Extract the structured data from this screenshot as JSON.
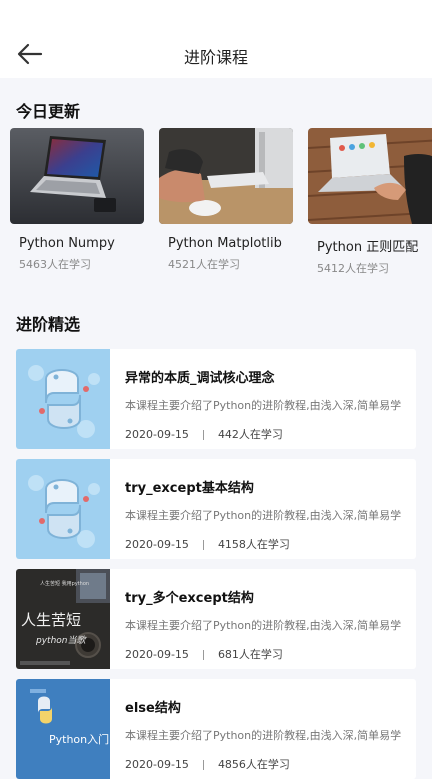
{
  "header": {
    "title": "进阶课程"
  },
  "today": {
    "title": "今日更新",
    "items": [
      {
        "name": "Python Numpy",
        "learners": "5463人在学习"
      },
      {
        "name": "Python Matplotlib",
        "learners": "4521人在学习"
      },
      {
        "name": "Python 正则匹配",
        "learners": "5412人在学习"
      }
    ]
  },
  "featured": {
    "title": "进阶精选",
    "items": [
      {
        "title": "异常的本质_调试核心理念",
        "desc": "本课程主要介绍了Python的进阶教程,由浅入深,简单易学",
        "date": "2020-09-15",
        "learners": "442人在学习"
      },
      {
        "title": "try_except基本结构",
        "desc": "本课程主要介绍了Python的进阶教程,由浅入深,简单易学",
        "date": "2020-09-15",
        "learners": "4158人在学习"
      },
      {
        "title": "try_多个except结构",
        "desc": "本课程主要介绍了Python的进阶教程,由浅入深,简单易学",
        "date": "2020-09-15",
        "learners": "681人在学习"
      },
      {
        "title": "else结构",
        "desc": "本课程主要介绍了Python的进阶教程,由浅入深,简单易学",
        "date": "2020-09-15",
        "learners": "4856人在学习"
      }
    ],
    "thumb_text": {
      "chalk_big": "人生苦短",
      "chalk_small": "python当歌",
      "chalk_note": "人生苦短 我用python",
      "python_intro": "Python入门"
    }
  }
}
